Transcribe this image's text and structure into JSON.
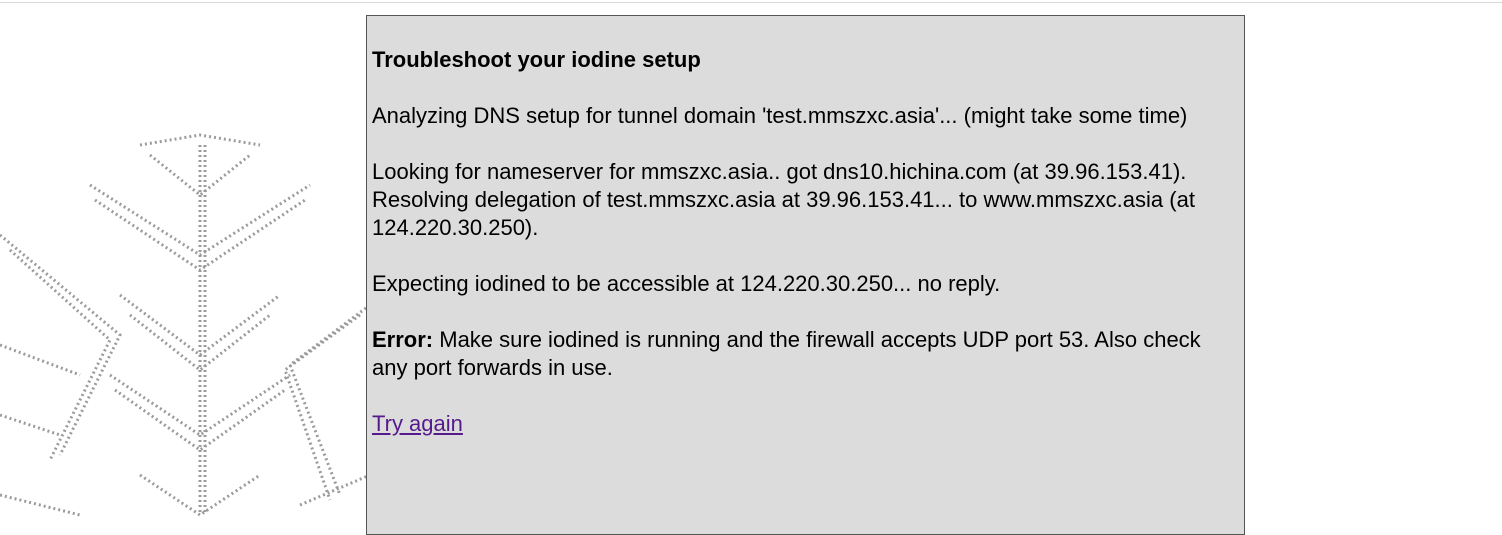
{
  "panel": {
    "title": "Troubleshoot your iodine setup",
    "analyzing": "Analyzing DNS setup for tunnel domain 'test.mmszxc.asia'... (might take some time)",
    "lookup_nameserver": "Looking for nameserver for mmszxc.asia.. got dns10.hichina.com (at 39.96.153.41).",
    "resolving": "Resolving delegation of test.mmszxc.asia at 39.96.153.41... to www.mmszxc.asia (at 124.220.30.250).",
    "expecting": "Expecting iodined to be accessible at 124.220.30.250... no reply.",
    "error_label": "Error:",
    "error_text": " Make sure iodined is running and the firewall accepts UDP port 53. Also check any port forwards in use.",
    "retry_link": "Try again"
  },
  "colors": {
    "panel_bg": "#dcdcdc",
    "panel_border": "#555555",
    "link": "#551a8b"
  },
  "decoration": {
    "background_image": "snowflake-graphic"
  }
}
